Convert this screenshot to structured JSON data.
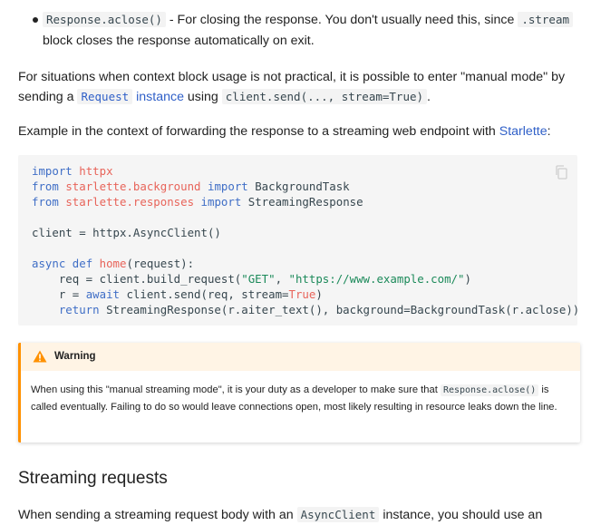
{
  "bullet": {
    "code": "Response.aclose()",
    "text_after_code": " - For closing the response. You don't usually need this, since ",
    "code2": ".stream",
    "text_end": " block closes the response automatically on exit."
  },
  "para1": {
    "text1": "For situations when context block usage is not practical, it is possible to enter \"manual mode\" by sending a ",
    "link_code": "Request",
    "link_text": " instance",
    "text2": " using ",
    "code": "client.send(..., stream=True)",
    "text3": "."
  },
  "para2": {
    "text1": "Example in the context of forwarding the response to a streaming web endpoint with ",
    "link": "Starlette",
    "text2": ":"
  },
  "code_block": {
    "icon": "copy-icon",
    "lines": [
      "import httpx",
      "from starlette.background import BackgroundTask",
      "from starlette.responses import StreamingResponse",
      "",
      "client = httpx.AsyncClient()",
      "",
      "async def home(request):",
      "    req = client.build_request(\"GET\", \"https://www.example.com/\")",
      "    r = await client.send(req, stream=True)",
      "    return StreamingResponse(r.aiter_text(), background=BackgroundTask(r.aclose))"
    ]
  },
  "warning": {
    "icon": "warning-icon",
    "title": "Warning",
    "text1": "When using this \"manual streaming mode\", it is your duty as a developer to make sure that ",
    "code": "Response.aclose()",
    "text2": " is called eventually. Failing to do so would leave connections open, most likely resulting in resource leaks down the line."
  },
  "section": {
    "heading": "Streaming requests",
    "text1": "When sending a streaming request body with an ",
    "code": "AsyncClient",
    "text2": " instance, you should use an"
  },
  "colors": {
    "link": "#3060c8",
    "keyword": "#3f6ec6",
    "module": "#e8645a",
    "string": "#1c8a5a",
    "warning_accent": "#ff9100",
    "warning_bg": "#fff4e5",
    "code_bg": "#f5f5f5"
  }
}
